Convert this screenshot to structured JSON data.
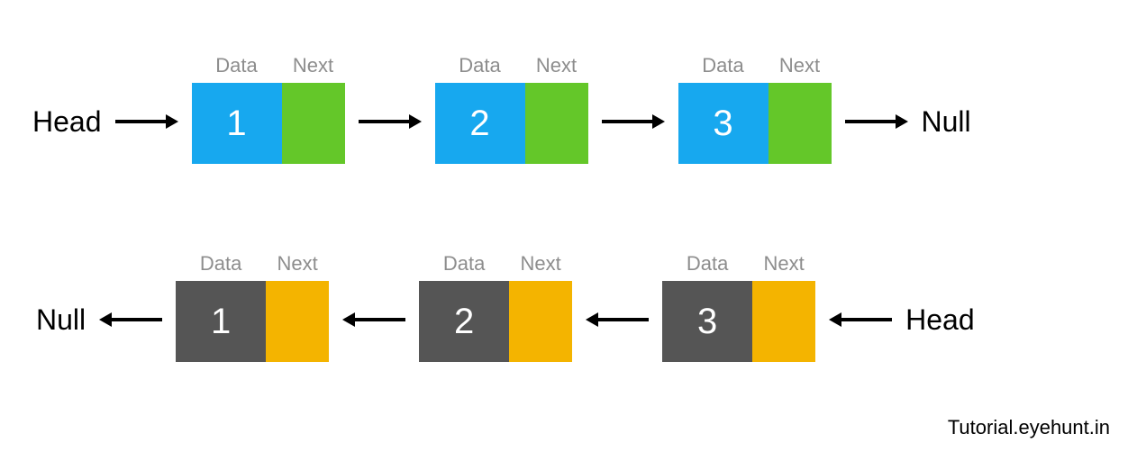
{
  "labels": {
    "data": "Data",
    "next": "Next",
    "head": "Head",
    "null": "Null"
  },
  "row1": {
    "start": "Head",
    "end": "Null",
    "direction": "right",
    "nodes": [
      {
        "value": "1",
        "dataColor": "#17a8ef",
        "nextColor": "#64c729"
      },
      {
        "value": "2",
        "dataColor": "#17a8ef",
        "nextColor": "#64c729"
      },
      {
        "value": "3",
        "dataColor": "#17a8ef",
        "nextColor": "#64c729"
      }
    ]
  },
  "row2": {
    "start": "Null",
    "end": "Head",
    "direction": "left",
    "nodes": [
      {
        "value": "1",
        "dataColor": "#555555",
        "nextColor": "#f4b400"
      },
      {
        "value": "2",
        "dataColor": "#555555",
        "nextColor": "#f4b400"
      },
      {
        "value": "3",
        "dataColor": "#555555",
        "nextColor": "#f4b400"
      }
    ]
  },
  "watermark": "Tutorial.eyehunt.in"
}
